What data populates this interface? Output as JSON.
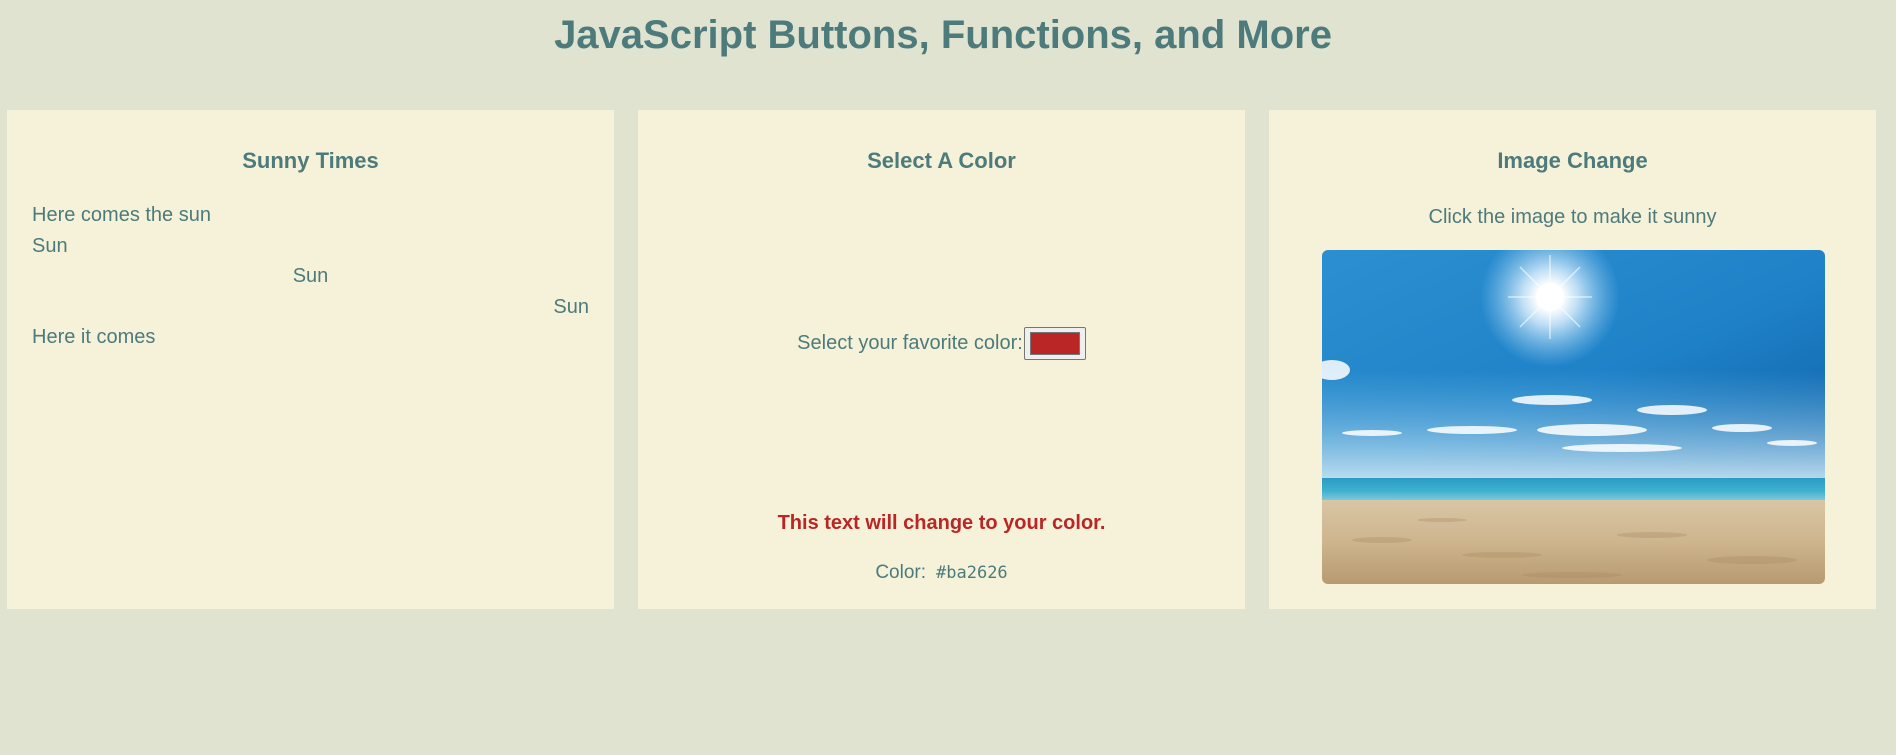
{
  "page": {
    "title": "JavaScript Buttons, Functions, and More"
  },
  "sunny": {
    "heading": "Sunny Times",
    "lines": [
      "Here comes the sun",
      "Sun",
      "Sun",
      "Sun",
      "Here it comes"
    ]
  },
  "color_picker": {
    "heading": "Select A Color",
    "label": "Select your favorite color:",
    "value": "#ba2626",
    "sample_text": "This text will change to your color.",
    "readout_label": "Color:",
    "readout_value": "#ba2626"
  },
  "image_change": {
    "heading": "Image Change",
    "caption": "Click the image to make it sunny",
    "image_name": "sunny-beach-image"
  },
  "colors": {
    "background": "#e1e3d1",
    "panel": "#f5f2d9",
    "text": "#4d7b7c",
    "selected": "#ba2626"
  }
}
